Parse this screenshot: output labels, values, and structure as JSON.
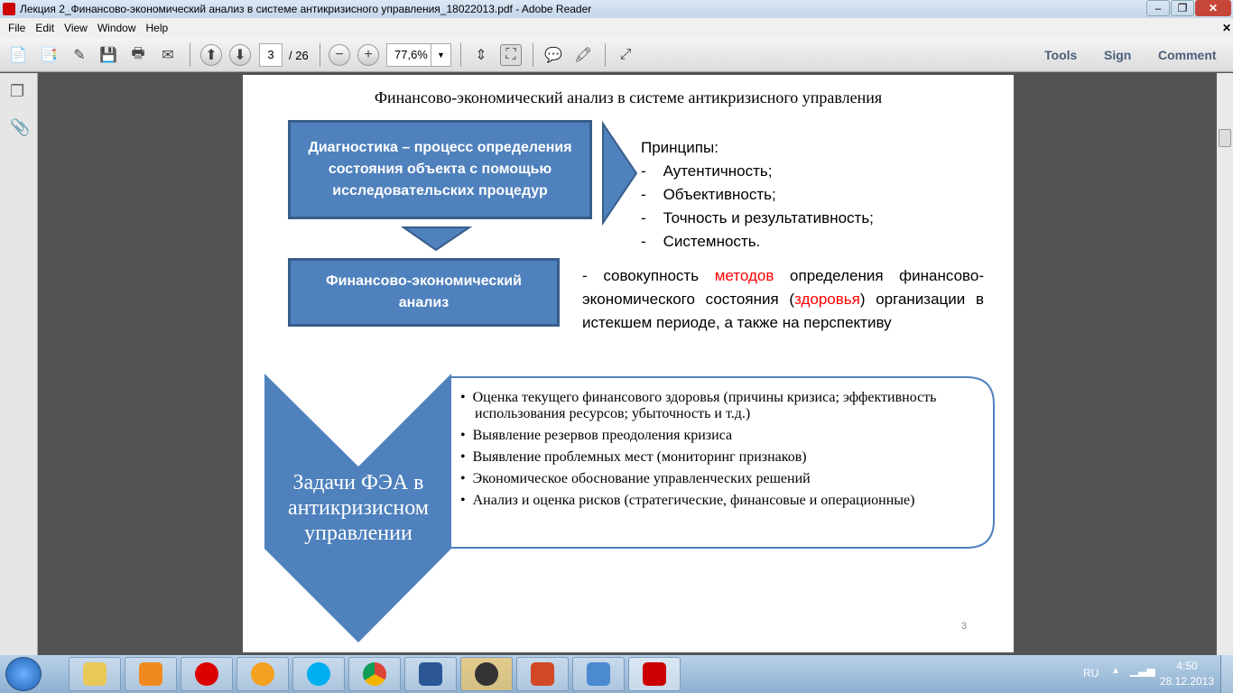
{
  "window": {
    "title": "Лекция 2_Финансово-экономический анализ в системе антикризисного управления_18022013.pdf - Adobe Reader"
  },
  "menu": [
    "File",
    "Edit",
    "View",
    "Window",
    "Help"
  ],
  "toolbar": {
    "page_current": "3",
    "page_total": "/ 26",
    "zoom": "77,6%",
    "tools": "Tools",
    "sign": "Sign",
    "comment": "Comment"
  },
  "slide": {
    "title": "Финансово-экономический анализ в системе антикризисного управления",
    "box1": "Диагностика – процесс определения состояния объекта с помощью исследовательских процедур",
    "principles_title": "Принципы:",
    "principles": [
      "Аутентичность;",
      "Объективность;",
      "Точность и результативность;",
      "Системность."
    ],
    "box2": "Финансово-экономический анализ",
    "def": {
      "p1": "- совокупность ",
      "red1": "методов",
      "p2": " определения финансово-экономического состояния (",
      "red2": "здоровья",
      "p3": ") организации в истекшем периоде, а также на перспективу"
    },
    "chevron": "Задачи ФЭА в антикризисном управлении",
    "tasks": [
      "Оценка текущего финансового здоровья (причины кризиса; эффективность использования ресурсов; убыточность и т.д.)",
      "Выявление резервов преодоления кризиса",
      "Выявление проблемных мест (мониторинг признаков)",
      "Экономическое обоснование управленческих решений",
      "Анализ и оценка рисков (стратегические, финансовые и операционные)"
    ],
    "page_number": "3",
    "colors": {
      "blue": "#4f81bd",
      "red": "#ff0000"
    }
  },
  "tray": {
    "lang": "RU",
    "time": "4:50",
    "date": "28.12.2013"
  }
}
